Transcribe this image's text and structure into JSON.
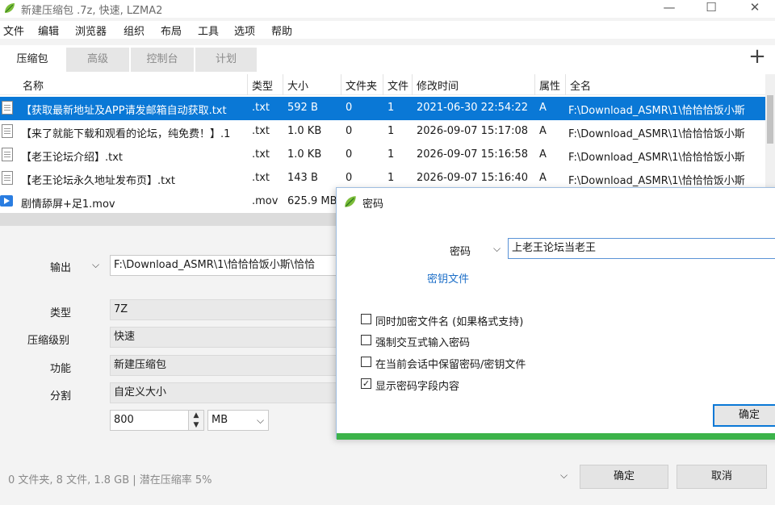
{
  "window": {
    "title": "新建压缩包 .7z, 快速, LZMA2",
    "minimize_glyph": "—",
    "maximize_glyph": "☐",
    "close_glyph": "✕"
  },
  "menu": [
    "文件",
    "编辑",
    "浏览器",
    "组织",
    "布局",
    "工具",
    "选项",
    "帮助"
  ],
  "tabs": [
    "压缩包",
    "高级",
    "控制台",
    "计划"
  ],
  "add_glyph": "+",
  "columns": [
    "名称",
    "类型",
    "大小",
    "文件夹",
    "文件",
    "修改时间",
    "属性",
    "全名"
  ],
  "files": [
    {
      "name": "【获取最新地址及APP请发邮箱自动获取.txt",
      "type": ".txt",
      "size": "592 B",
      "folders": "0",
      "files": "1",
      "modified": "2021-06-30 22:54:22",
      "attr": "A",
      "fullname": "F:\\Download_ASMR\\1\\恰恰恰饭小斯",
      "icon": "text-file-icon",
      "selected": true
    },
    {
      "name": "【来了就能下载和观看的论坛，纯免费！】.1",
      "type": ".txt",
      "size": "1.0 KB",
      "folders": "0",
      "files": "1",
      "modified": "2026-09-07 15:17:08",
      "attr": "A",
      "fullname": "F:\\Download_ASMR\\1\\恰恰恰饭小斯",
      "icon": "text-file-icon",
      "selected": false
    },
    {
      "name": "【老王论坛介绍】.txt",
      "type": ".txt",
      "size": "1.0 KB",
      "folders": "0",
      "files": "1",
      "modified": "2026-09-07 15:16:58",
      "attr": "A",
      "fullname": "F:\\Download_ASMR\\1\\恰恰恰饭小斯",
      "icon": "text-file-icon",
      "selected": false
    },
    {
      "name": "【老王论坛永久地址发布页】.txt",
      "type": ".txt",
      "size": "143 B",
      "folders": "0",
      "files": "1",
      "modified": "2026-09-07 15:16:40",
      "attr": "A",
      "fullname": "F:\\Download_ASMR\\1\\恰恰恰饭小斯",
      "icon": "text-file-icon",
      "selected": false
    },
    {
      "name": "剧情舔屏+足1.mov",
      "type": ".mov",
      "size": "625.9 MB",
      "folders": "",
      "files": "",
      "modified": "",
      "attr": "",
      "fullname": "",
      "icon": "video-file-icon",
      "selected": false
    }
  ],
  "form": {
    "output_label": "输出",
    "output_value": "F:\\Download_ASMR\\1\\恰恰恰饭小斯\\恰恰",
    "type_label": "类型",
    "type_value": "7Z",
    "level_label": "压缩级别",
    "level_value": "快速",
    "function_label": "功能",
    "function_value": "新建压缩包",
    "split_label": "分割",
    "split_value": "自定义大小",
    "split_size": "800",
    "split_unit": "MB"
  },
  "status": "0 文件夹,  8 文件,  1.8 GB | 潜在压缩率 5%",
  "buttons": {
    "ok": "确定",
    "cancel": "取消"
  },
  "dialog": {
    "title": "密码",
    "password_label": "密码",
    "password_value": "上老王论坛当老王",
    "keyfile_link": "密钥文件",
    "options": [
      {
        "label": "同时加密文件名 (如果格式支持)",
        "checked": false
      },
      {
        "label": "强制交互式输入密码",
        "checked": false
      },
      {
        "label": "在当前会话中保留密码/密钥文件",
        "checked": false
      },
      {
        "label": "显示密码字段内容",
        "checked": true
      }
    ],
    "ok": "确定"
  },
  "colors": {
    "selection": "#0a78d6",
    "accent_green": "#3cb34a",
    "link": "#1d6fc8"
  }
}
